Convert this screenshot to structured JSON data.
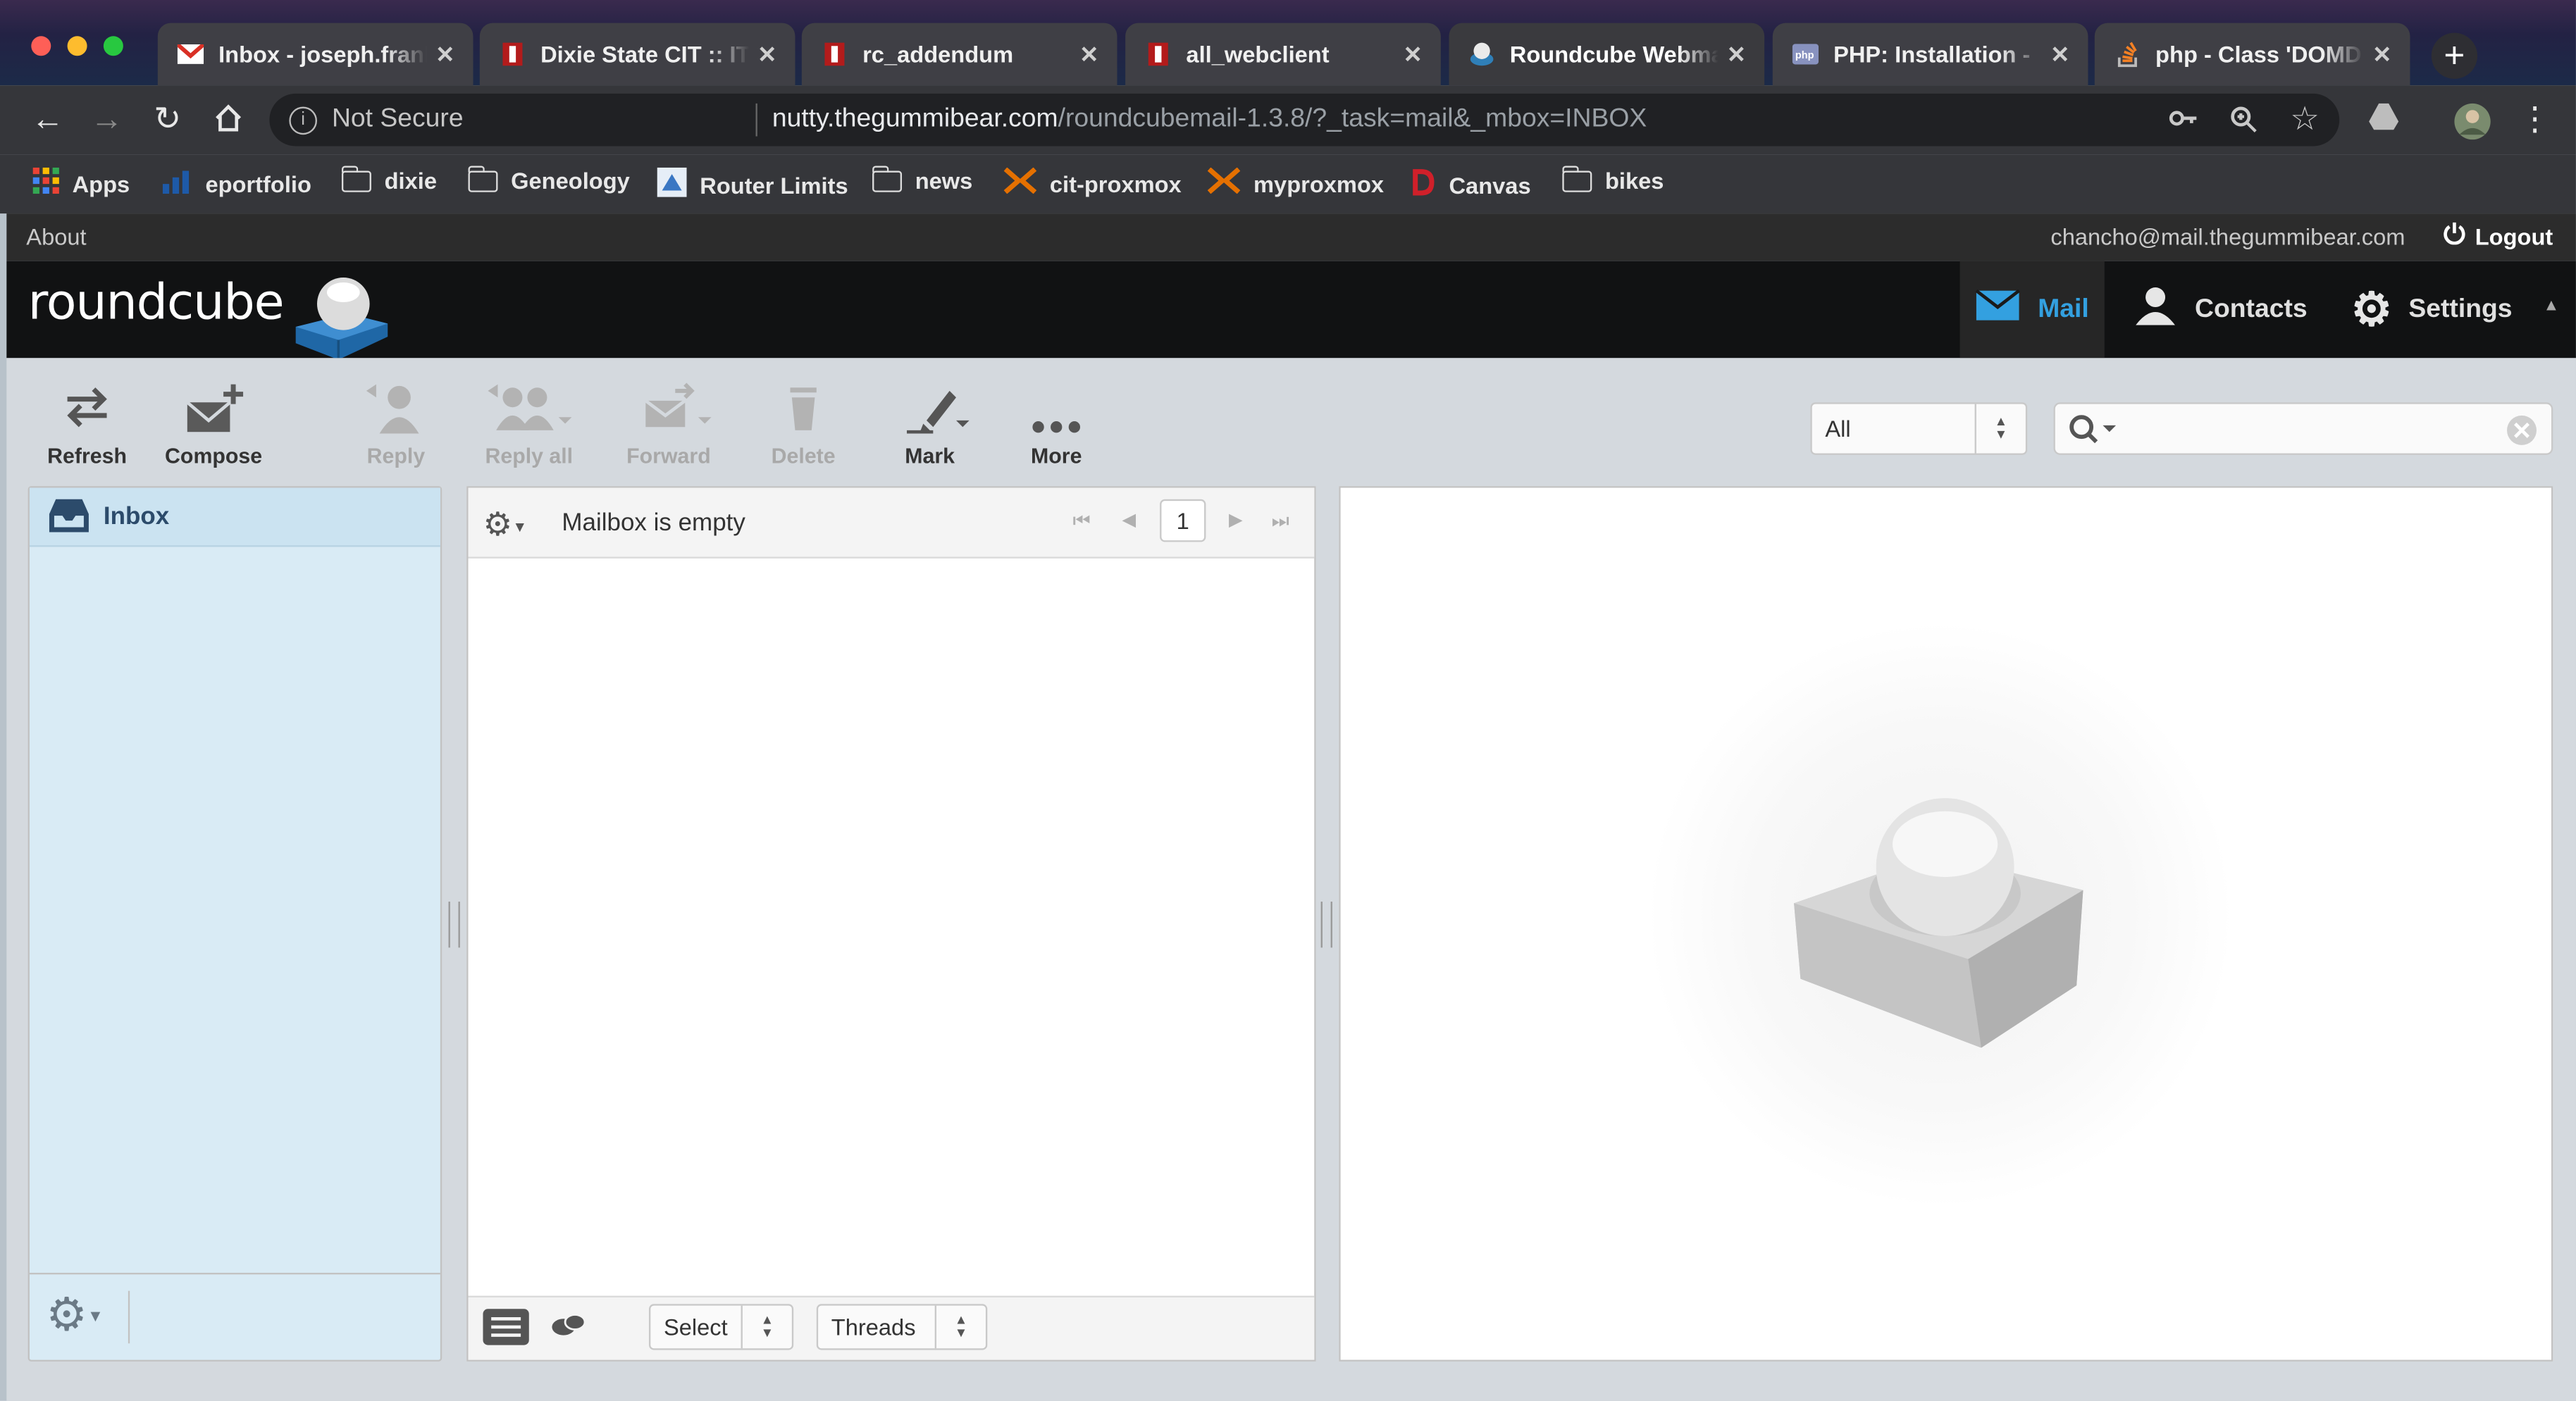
{
  "browser": {
    "tabs": [
      {
        "title": "Inbox - joseph.franks",
        "favicon": "gmail-icon"
      },
      {
        "title": "Dixie State CIT :: IT",
        "favicon": "dixie-icon"
      },
      {
        "title": "rc_addendum",
        "favicon": "dixie-icon"
      },
      {
        "title": "all_webclient",
        "favicon": "dixie-icon"
      },
      {
        "title": "Roundcube Webmail",
        "favicon": "roundcube-icon"
      },
      {
        "title": "PHP: Installation -",
        "favicon": "php-icon"
      },
      {
        "title": "php - Class 'DOMD",
        "favicon": "stackoverflow-icon"
      }
    ],
    "active_tab": 4,
    "security_label": "Not Secure",
    "url_host": "nutty.thegummibear.com",
    "url_path": "/roundcubemail-1.3.8/?_task=mail&_mbox=INBOX",
    "bookmarks": [
      "Apps",
      "eportfolio",
      "dixie",
      "Geneology",
      "Router Limits",
      "news",
      "cit-proxmox",
      "myproxmox",
      "Canvas",
      "bikes"
    ]
  },
  "roundcube": {
    "topline": {
      "about": "About",
      "user": "chancho@mail.thegummibear.com",
      "logout": "Logout"
    },
    "logo_text": "roundcube",
    "nav": {
      "mail": "Mail",
      "contacts": "Contacts",
      "settings": "Settings"
    },
    "toolbar": {
      "refresh": "Refresh",
      "compose": "Compose",
      "reply": "Reply",
      "reply_all": "Reply all",
      "forward": "Forward",
      "delete": "Delete",
      "mark": "Mark",
      "more": "More"
    },
    "filter": {
      "selected": "All"
    },
    "search": {
      "placeholder": ""
    },
    "folders": [
      {
        "name": "Inbox"
      }
    ],
    "list": {
      "status": "Mailbox is empty",
      "page": "1"
    },
    "footer": {
      "select_label": "Select",
      "threads_label": "Threads"
    },
    "colors": {
      "accent": "#33a0e0",
      "header": "#111213",
      "folder_pane": "#d9ebf5"
    }
  }
}
